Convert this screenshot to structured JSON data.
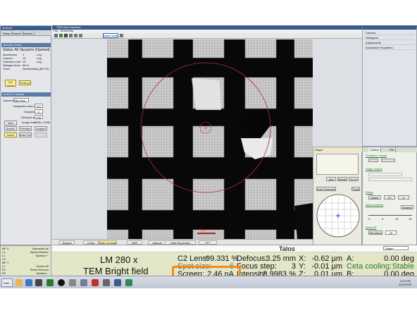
{
  "left_panel": {
    "window_title": "Workset",
    "tabs": [
      "Setup",
      "Search",
      "Camera"
    ],
    "vacuum": {
      "header": "Vacuum (User)",
      "status": "Status: All Vacuums (Opened)",
      "rows": [
        {
          "label": "Accelerator",
          "value": "1",
          "unit": "Log"
        },
        {
          "label": "Column",
          "value": "10",
          "unit": "Log"
        },
        {
          "label": "Detection Unit",
          "value": "14",
          "unit": "Log"
        },
        {
          "label": "Nitrogen level",
          "value": "56 %",
          "unit": ""
        },
        {
          "label": "Turbo",
          "value": "Decelerating (85.7%)",
          "unit": ""
        }
      ],
      "buttons": [
        "Col. Valve Closed",
        "Turbo pump"
      ]
    },
    "camera": {
      "header": "CCD/TV Camera",
      "camera_label": "Camera",
      "camera_value": "BM-Ceta",
      "integration_label": "Integration time (s)",
      "integration_value": "0.4",
      "sampling_label": "Sampling",
      "sampling_value": "2",
      "readout_label": "Readout area",
      "readout_value": "Full",
      "image_size_label": "Image size:",
      "image_size_value": "4096 x 4096",
      "buttons": [
        "View",
        "Search",
        "Preview",
        "Acquire",
        "Insert",
        "Auto Focus"
      ]
    },
    "bottom_list": [
      {
        "left": "MF X",
        "right": "Normalize all"
      },
      {
        "left": "L1",
        "right": "Alpha Wobbler"
      },
      {
        "left": "L2",
        "right": "Spotsize +"
      },
      {
        "left": "L3",
        "right": ""
      },
      {
        "left": "MF Y",
        "right": ""
      },
      {
        "left": "L1",
        "right": "Screen lift"
      },
      {
        "left": "R1",
        "right": "Reset Defocus"
      },
      {
        "left": "R2",
        "right": "Spotsize -"
      },
      {
        "left": "R3",
        "right": ""
      }
    ]
  },
  "center": {
    "window_title": "TEM User Interface",
    "menu": [
      "File",
      "Mode",
      "Help"
    ],
    "insert_screen_label": "Insert Screen",
    "scale_bar_label": "5 µm",
    "filters": [
      "Natural",
      "Linear",
      "High Contrast",
      "HDR",
      "Manual",
      "High Resolution",
      "FFT"
    ],
    "active_filter": "High Contrast"
  },
  "stage_panel": {
    "title": "Stage*",
    "position_label": "Position / tracks",
    "buttons": [
      "Add",
      "Delete",
      "Go to",
      "Auto Eucentric",
      "Track"
    ]
  },
  "right_tools": {
    "tabs": [
      "Control",
      "File"
    ],
    "sections": [
      "Positions / tracks",
      "Stage control",
      "Reset",
      "Alpha wobbler",
      "Alpha tilt"
    ],
    "reset_buttons": [
      "Holder",
      "XY",
      "A"
    ],
    "wobbler_button": "Wobble",
    "slider_ticks": [
      "0",
      "5",
      "10",
      "15"
    ],
    "set_alpha_button": "Set Alpha",
    "set_alpha_value": "25"
  },
  "right_panel": {
    "items": [
      "Camera",
      "Histogram",
      "Adjustments",
      "Annotation Properties"
    ]
  },
  "status_bar": {
    "app_name": "Talos",
    "mag": "LM 280 x",
    "mode": "TEM Bright field",
    "dropdown_value": "Stage*",
    "c2_label": "C2 Lens:",
    "c2_value": "99.331 %",
    "spot_label": "Spot size:",
    "spot_value": "6",
    "intensity_label": "Intensity:",
    "intensity_value": "5.9983 %",
    "screen_label": "Screen:",
    "screen_value": "2.46 nA",
    "defocus_label": "Defocus:",
    "defocus_value": "3.25 mm",
    "focus_label": "Focus step:",
    "focus_value": "3",
    "x_label": "X:",
    "x_value": "-0.62 µm",
    "y_label": "Y:",
    "y_value": "-0.01 µm",
    "z_label": "Z:",
    "z_value": "0.01 µm",
    "a_label": "A:",
    "a_value": "0.00 deg",
    "b_label": "B:",
    "b_value": "0.00 deg",
    "ceta_label": "Ceta cooling:",
    "ceta_value": "Stable",
    "highlight_color": "#f08a1c",
    "green_color": "#2a7a2a",
    "bg_color": "#e4e6c8"
  },
  "taskbar": {
    "start_label": "Start",
    "time": "3:14 PM",
    "date": "4/21/2016"
  }
}
